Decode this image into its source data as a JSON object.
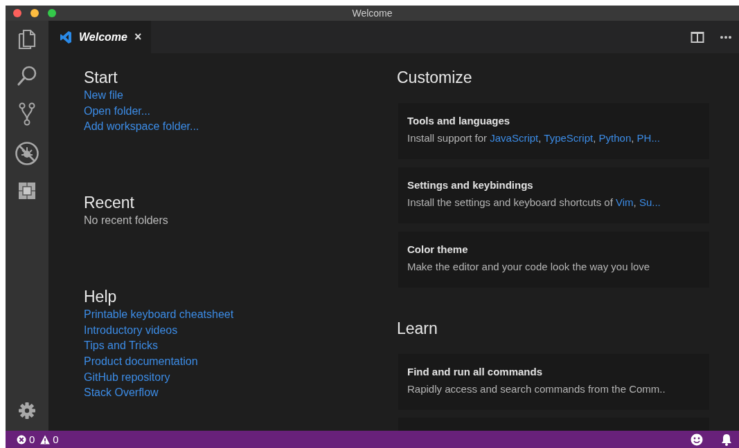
{
  "window": {
    "title": "Welcome"
  },
  "tabs": [
    {
      "label": "Welcome",
      "close": "×",
      "selected": true
    }
  ],
  "sections_left": [
    {
      "heading": "Start",
      "items": [
        {
          "kind": "link",
          "text": "New file"
        },
        {
          "kind": "link",
          "text": "Open folder..."
        },
        {
          "kind": "link",
          "text": "Add workspace folder..."
        }
      ]
    },
    {
      "heading": "Recent",
      "items": [
        {
          "kind": "text",
          "text": "No recent folders"
        }
      ]
    },
    {
      "heading": "Help",
      "items": [
        {
          "kind": "link",
          "text": "Printable keyboard cheatsheet"
        },
        {
          "kind": "link",
          "text": "Introductory videos"
        },
        {
          "kind": "link",
          "text": "Tips and Tricks"
        },
        {
          "kind": "link",
          "text": "Product documentation"
        },
        {
          "kind": "link",
          "text": "GitHub repository"
        },
        {
          "kind": "link",
          "text": "Stack Overflow"
        }
      ]
    }
  ],
  "sections_right": [
    {
      "heading": "Customize",
      "cards": [
        {
          "title": "Tools and languages",
          "description": [
            {
              "kind": "text",
              "text": "Install support for "
            },
            {
              "kind": "link",
              "text": "JavaScript"
            },
            {
              "kind": "text",
              "text": ", "
            },
            {
              "kind": "link",
              "text": "TypeScript"
            },
            {
              "kind": "text",
              "text": ", "
            },
            {
              "kind": "link",
              "text": "Python"
            },
            {
              "kind": "text",
              "text": ", "
            },
            {
              "kind": "link",
              "text": "PH..."
            }
          ]
        },
        {
          "title": "Settings and keybindings",
          "description": [
            {
              "kind": "text",
              "text": "Install the settings and keyboard shortcuts of "
            },
            {
              "kind": "link",
              "text": "Vim"
            },
            {
              "kind": "text",
              "text": ", "
            },
            {
              "kind": "link",
              "text": "Su..."
            }
          ]
        },
        {
          "title": "Color theme",
          "description": [
            {
              "kind": "text",
              "text": "Make the editor and your code look the way you love"
            }
          ]
        }
      ]
    },
    {
      "heading": "Learn",
      "cards": [
        {
          "title": "Find and run all commands",
          "description": [
            {
              "kind": "text",
              "text": "Rapidly access and search commands from the Comm.."
            }
          ]
        }
      ]
    }
  ],
  "status_bar": {
    "errors": "0",
    "warnings": "0"
  }
}
